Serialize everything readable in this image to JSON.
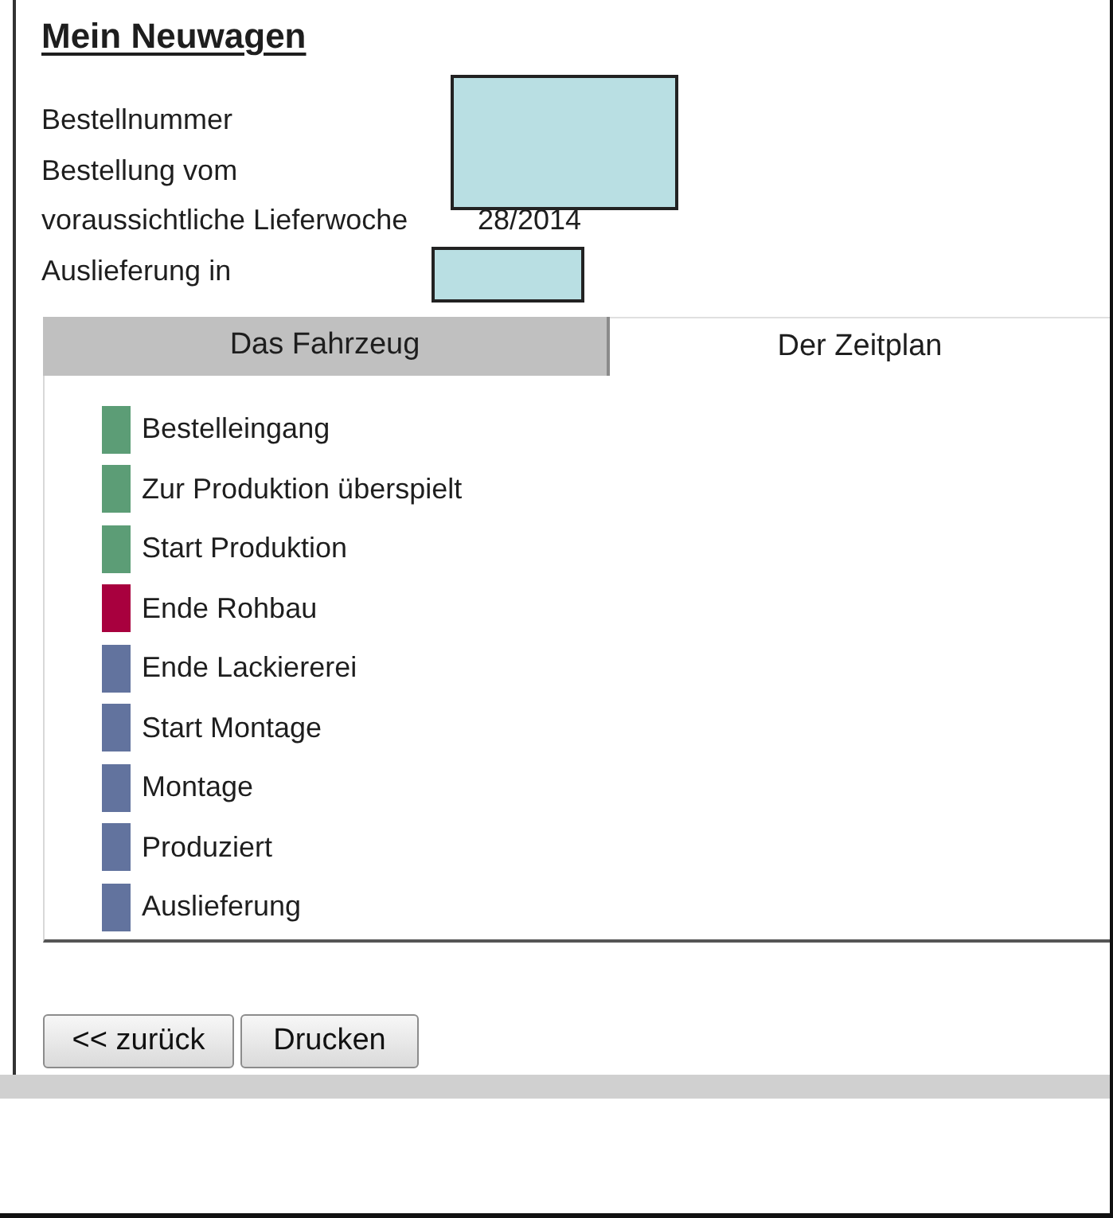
{
  "title": "Mein Neuwagen",
  "fields": [
    {
      "label": "Bestellnummer",
      "redacted": true
    },
    {
      "label": "Bestellung vom",
      "redacted": true
    },
    {
      "label": "voraussichtliche Lieferwoche",
      "value": "28/2014"
    },
    {
      "label": "Auslieferung in",
      "redacted": true
    }
  ],
  "tabs": [
    {
      "label": "Das Fahrzeug",
      "selected": false
    },
    {
      "label": "Der Zeitplan",
      "selected": true
    }
  ],
  "timeline": [
    {
      "label": "Bestelleingang",
      "color": "#5c9d76"
    },
    {
      "label": "Zur Produktion überspielt",
      "color": "#5c9d76"
    },
    {
      "label": "Start Produktion",
      "color": "#5c9d76"
    },
    {
      "label": "Ende Rohbau",
      "color": "#a8003e"
    },
    {
      "label": "Ende Lackiererei",
      "color": "#62739e"
    },
    {
      "label": "Start Montage",
      "color": "#62739e"
    },
    {
      "label": "Montage",
      "color": "#62739e"
    },
    {
      "label": "Produziert",
      "color": "#62739e"
    },
    {
      "label": "Auslieferung",
      "color": "#62739e"
    }
  ],
  "buttons": [
    {
      "label": "<< zurück"
    },
    {
      "label": "Drucken"
    }
  ]
}
